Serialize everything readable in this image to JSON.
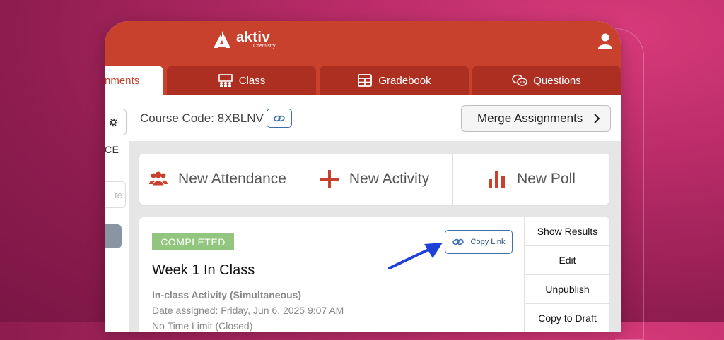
{
  "brand": {
    "name": "aktiv",
    "subtitle": "Chemistry"
  },
  "tabs": [
    {
      "label": "nments",
      "icon": "",
      "active": true
    },
    {
      "label": "Class",
      "icon": "class-icon",
      "active": false
    },
    {
      "label": "Gradebook",
      "icon": "gradebook-icon",
      "active": false
    },
    {
      "label": "Questions",
      "icon": "questions-icon",
      "active": false
    }
  ],
  "left_panel": {
    "label": "CE",
    "input_placeholder": "te"
  },
  "course": {
    "label": "Course Code: 8XBLNV"
  },
  "merge_button": {
    "label": "Merge Assignments"
  },
  "actions": [
    {
      "label": "New Attendance",
      "icon": "attendance-icon"
    },
    {
      "label": "New Activity",
      "icon": "plus-icon"
    },
    {
      "label": "New Poll",
      "icon": "poll-icon"
    }
  ],
  "assignment": {
    "status": "COMPLETED",
    "title": "Week 1 In Class",
    "type": "In-class Activity (Simultaneous)",
    "date": "Date assigned: Friday, Jun 6, 2025 9:07 AM",
    "extra": "No Time Limit (Closed)",
    "copy_link_label": "Copy Link"
  },
  "side_menu": [
    "Show Results",
    "Edit",
    "Unpublish",
    "Copy to Draft"
  ],
  "colors": {
    "brand": "#c8412c",
    "tab": "#ad2f22",
    "badge": "#92c57d",
    "link": "#3d6fa9",
    "arrow": "#1f3fd6"
  }
}
